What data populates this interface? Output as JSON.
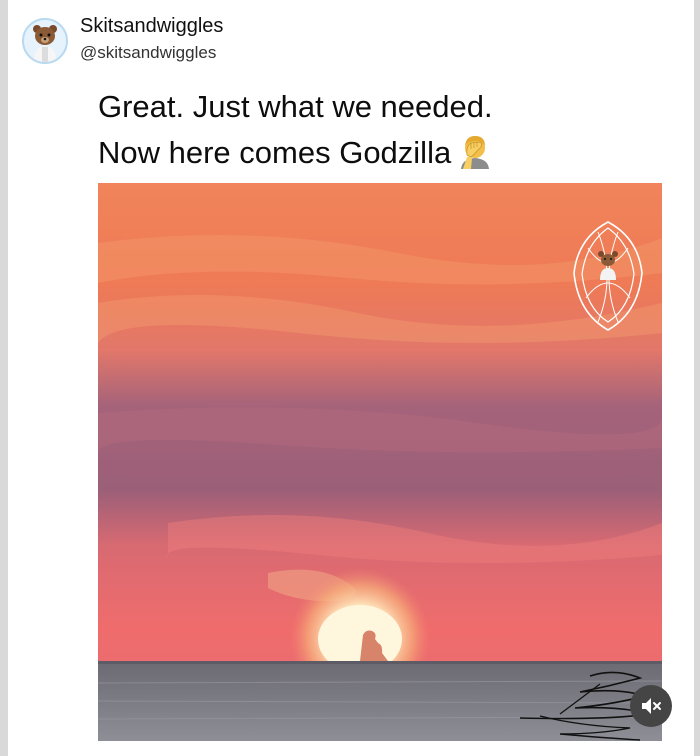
{
  "account": {
    "display_name": "Skitsandwiggles",
    "handle": "@skitsandwiggles"
  },
  "post": {
    "lines": [
      "Great. Just what we needed.",
      "Now here comes Godzilla"
    ],
    "emoji": "facepalm"
  },
  "media": {
    "kind": "sunset-over-sea-photo",
    "colors": {
      "sky_top": "#f07a52",
      "sky_mid": "#a0627a",
      "sun": "#fff7e0",
      "sea": "#6e6f78"
    }
  },
  "controls": {
    "mute_icon": "muted-speaker-icon"
  }
}
